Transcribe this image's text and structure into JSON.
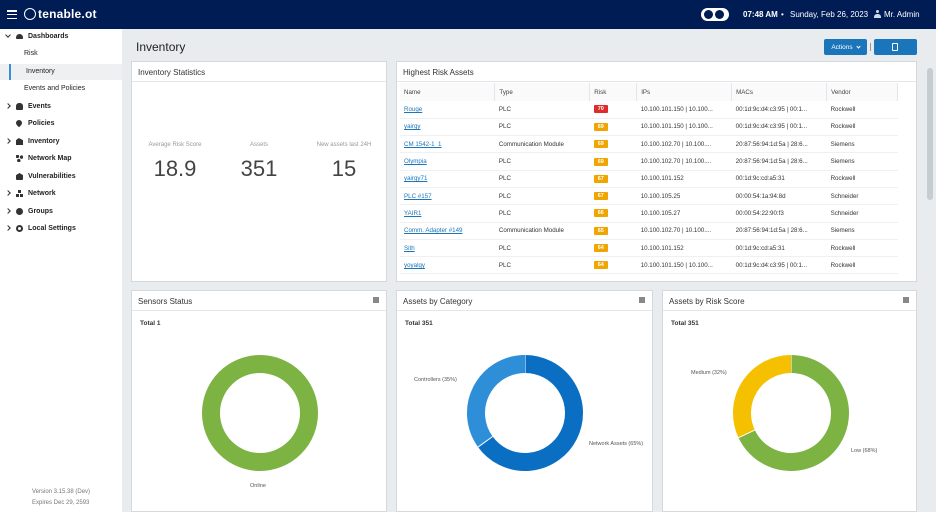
{
  "header": {
    "brand": "tenable.ot",
    "time": "07:48 AM",
    "separator": "•",
    "date": "Sunday, Feb 26, 2023",
    "user": "Mr. Admin"
  },
  "sidebar": {
    "items": [
      {
        "label": "Dashboards",
        "icon": "cloud-icon",
        "expanded": true
      },
      {
        "label": "Risk"
      },
      {
        "label": "Inventory",
        "active": true
      },
      {
        "label": "Events and Policies"
      },
      {
        "label": "Events",
        "icon": "bell-icon"
      },
      {
        "label": "Policies",
        "icon": "pin-icon"
      },
      {
        "label": "Inventory",
        "icon": "inventory-icon"
      },
      {
        "label": "Network Map",
        "icon": "network-map-icon"
      },
      {
        "label": "Vulnerabilities",
        "icon": "vulnerability-icon"
      },
      {
        "label": "Network",
        "icon": "sitemap-icon"
      },
      {
        "label": "Groups",
        "icon": "groups-icon"
      },
      {
        "label": "Local Settings",
        "icon": "gear-icon"
      }
    ],
    "version": "Version 3.15.38 (Dev)",
    "expires": "Expires Dec 29, 2593"
  },
  "page": {
    "title": "Inventory",
    "actions_label": "Actions"
  },
  "stats": {
    "title": "Inventory Statistics",
    "avg_risk_label": "Average Risk Score",
    "avg_risk_value": "18.9",
    "assets_label": "Assets",
    "assets_value": "351",
    "new_label": "New assets last 24H",
    "new_value": "15"
  },
  "risk_table": {
    "title": "Highest Risk Assets",
    "columns": [
      "Name",
      "Type",
      "Risk",
      "IPs",
      "MACs",
      "Vendor"
    ],
    "rows": [
      {
        "name": "Rouge",
        "type": "PLC",
        "risk": "70",
        "color": "#e02b2b",
        "ips": "10.100.101.150 | 10.100...",
        "macs": "00:1d:9c:d4:c3:95 | 00:1...",
        "vendor": "Rockwell"
      },
      {
        "name": "yairgy",
        "type": "PLC",
        "risk": "69",
        "color": "#f0a500",
        "ips": "10.100.101.150 | 10.100...",
        "macs": "00:1d:9c:d4:c3:95 | 00:1...",
        "vendor": "Rockwell"
      },
      {
        "name": "CM 1542-1_1",
        "type": "Communication Module",
        "risk": "69",
        "color": "#f0a500",
        "ips": "10.100.102.70 | 10.100....",
        "macs": "20:87:56:94:1d:5a | 28:6...",
        "vendor": "Siemens"
      },
      {
        "name": "Olympia",
        "type": "PLC",
        "risk": "69",
        "color": "#f0a500",
        "ips": "10.100.102.70 | 10.100....",
        "macs": "20:87:56:94:1d:5a | 28:6...",
        "vendor": "Siemens"
      },
      {
        "name": "yairgy71",
        "type": "PLC",
        "risk": "67",
        "color": "#f0a500",
        "ips": "10.100.101.152",
        "macs": "00:1d:9c:cd:a5:31",
        "vendor": "Rockwell"
      },
      {
        "name": "PLC #157",
        "type": "PLC",
        "risk": "67",
        "color": "#f0a500",
        "ips": "10.100.105.25",
        "macs": "00:00:54:1a:94:8d",
        "vendor": "Schneider"
      },
      {
        "name": "YAIR1",
        "type": "PLC",
        "risk": "66",
        "color": "#f0a500",
        "ips": "10.100.105.27",
        "macs": "00:00:54:22:90:f3",
        "vendor": "Schneider"
      },
      {
        "name": "Comm. Adapter #149",
        "type": "Communication Module",
        "risk": "65",
        "color": "#f0a500",
        "ips": "10.100.102.70 | 10.100....",
        "macs": "20:87:56:94:1d:5a | 28:6...",
        "vendor": "Siemens"
      },
      {
        "name": "Sith",
        "type": "PLC",
        "risk": "64",
        "color": "#f0a500",
        "ips": "10.100.101.152",
        "macs": "00:1d:9c:cd:a5:31",
        "vendor": "Rockwell"
      },
      {
        "name": "yoyalgy",
        "type": "PLC",
        "risk": "64",
        "color": "#f0a500",
        "ips": "10.100.101.150 | 10.100...",
        "macs": "00:1d:9c:d4:c3:95 | 00:1...",
        "vendor": "Rockwell"
      }
    ]
  },
  "sensors": {
    "title": "Sensors Status",
    "total": "Total 1",
    "slices": [
      {
        "label": "Online",
        "value": 1,
        "color": "#7cb342"
      }
    ]
  },
  "category": {
    "title": "Assets by Category",
    "total": "Total 351",
    "slices": [
      {
        "label": "Network Assets (65%)",
        "value": 65,
        "color": "#0a6fc2"
      },
      {
        "label": "Controllers (35%)",
        "value": 35,
        "color": "#2e8fd8"
      }
    ]
  },
  "risk_score": {
    "title": "Assets by Risk Score",
    "total": "Total 351",
    "slices": [
      {
        "label": "Low (68%)",
        "value": 68,
        "color": "#7cb342"
      },
      {
        "label": "Medium (32%)",
        "value": 32,
        "color": "#f5c000"
      }
    ]
  }
}
